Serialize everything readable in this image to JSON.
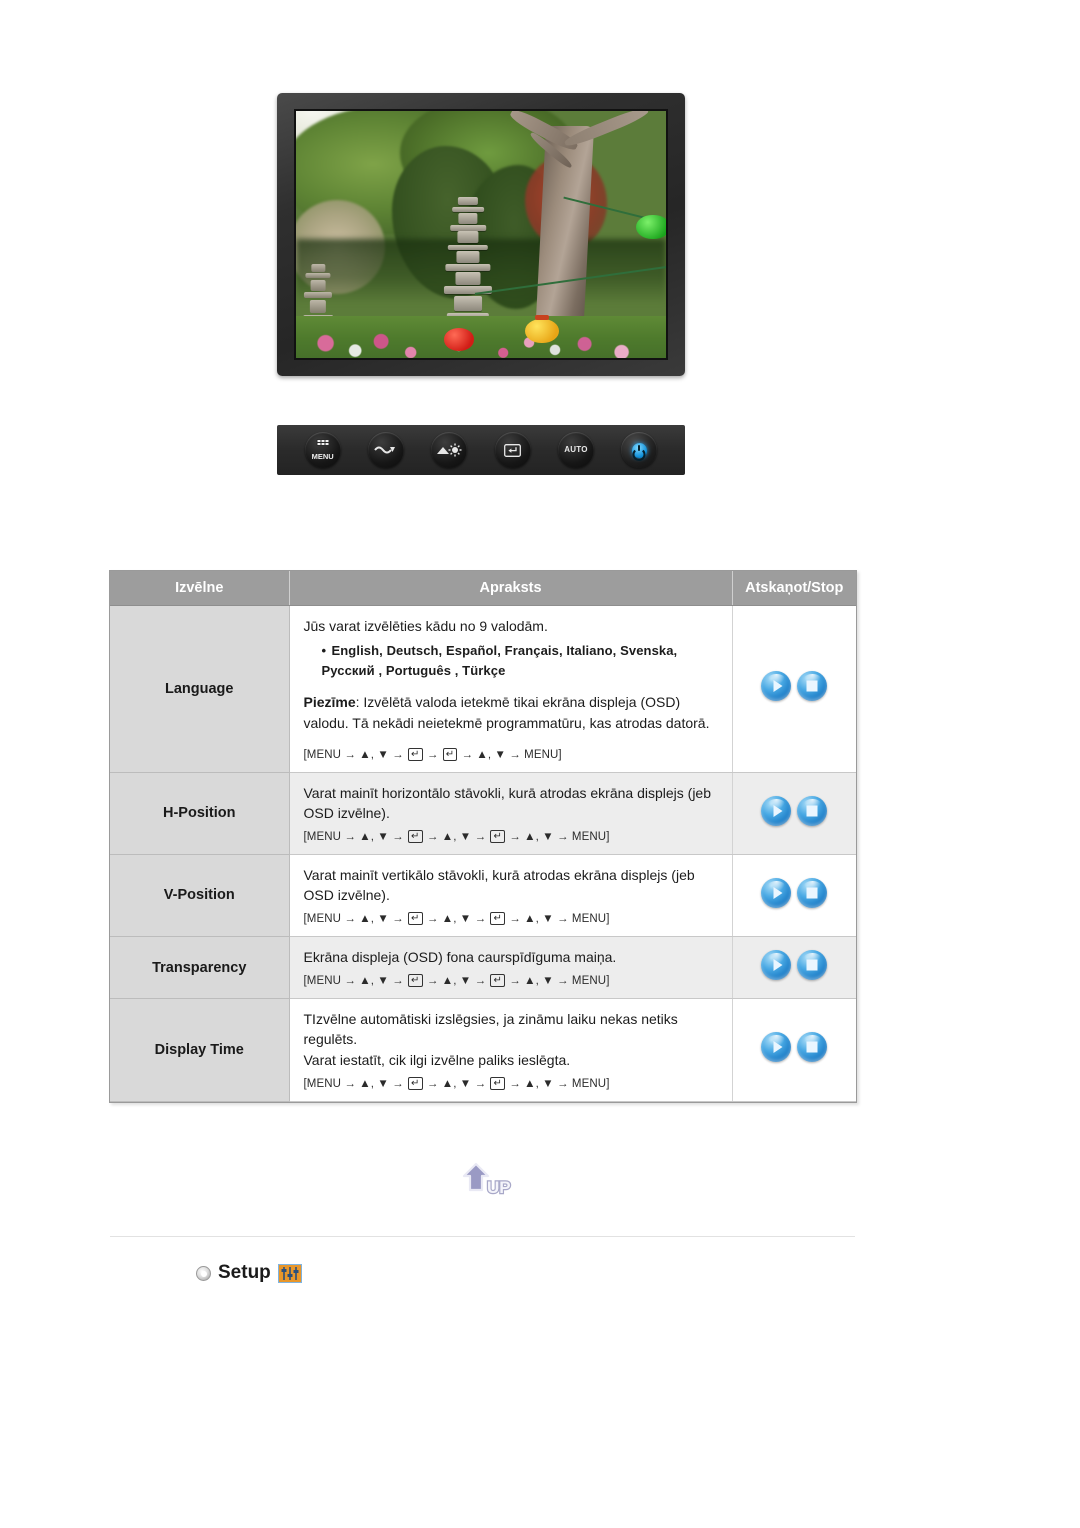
{
  "monitor": {
    "screen_alt": "garden-photo-with-stone-pagoda",
    "controls": [
      {
        "name": "menu-button",
        "label": "MENU"
      },
      {
        "name": "source-down-button",
        "label": "SOURCE"
      },
      {
        "name": "brightness-button",
        "label": "BRIGHTNESS"
      },
      {
        "name": "enter-button",
        "label": "ENTER"
      },
      {
        "name": "auto-button",
        "label": "AUTO"
      },
      {
        "name": "power-button",
        "label": "POWER"
      }
    ]
  },
  "table": {
    "headers": {
      "menu": "Izvēlne",
      "description": "Apraksts",
      "playstop": "Atskaņot/Stop"
    },
    "rows": [
      {
        "menu": "Language",
        "intro": "Jūs varat izvēlēties kādu no 9 valodām.",
        "languages": "English, Deutsch, Español, Français,  Italiano, Svenska, Русский , Português , Türkçe",
        "note_label": "Piezīme",
        "note_text": ": Izvēlētā valoda ietekmē tikai ekrāna displeja (OSD) valodu. Tā nekādi neietekmē programmatūru, kas atrodas datorā.",
        "path": "[MENU → ▲, ▼ → ENTER → ENTER → ▲, ▼ → MENU]",
        "path_short": true
      },
      {
        "menu": "H-Position",
        "description": "Varat mainīt horizontālo stāvokli, kurā atrodas ekrāna displejs (jeb OSD izvēlne).",
        "path": "[MENU → ▲, ▼ → ENTER → ▲, ▼ → ENTER → ▲, ▼ → MENU]"
      },
      {
        "menu": "V-Position",
        "description": "Varat mainīt vertikālo stāvokli, kurā atrodas ekrāna displejs (jeb OSD izvēlne).",
        "path": "[MENU → ▲, ▼ → ENTER → ▲, ▼ → ENTER → ▲, ▼ → MENU]"
      },
      {
        "menu": "Transparency",
        "description": "Ekrāna displeja (OSD) fona caurspīdīguma maiņa.",
        "path": "[MENU → ▲, ▼ → ENTER → ▲, ▼ → ENTER → ▲, ▼ → MENU]"
      },
      {
        "menu": "Display Time",
        "description_line1": "TIzvēlne automātiski izslēgsies, ja zināmu laiku nekas netiks regulēts.",
        "description_line2": "Varat iestatīt, cik ilgi izvēlne paliks ieslēgta.",
        "path": "[MENU → ▲, ▼ → ENTER → ▲, ▼ → ENTER → ▲, ▼ → MENU]"
      }
    ],
    "action_icons": {
      "play": "play-icon",
      "stop": "stop-icon"
    }
  },
  "up_button": {
    "label": "UP"
  },
  "setup_section": {
    "title": "Setup",
    "icon": "setup-sliders-icon"
  },
  "colors": {
    "header_bg": "#9d9d9d",
    "menu_cell_bg": "#d9d9d9",
    "alt_row_bg": "#ededed",
    "orb_blue": "#2f93d8",
    "setup_icon_orange": "#e8962a",
    "up_purple": "#9a9ac4"
  }
}
